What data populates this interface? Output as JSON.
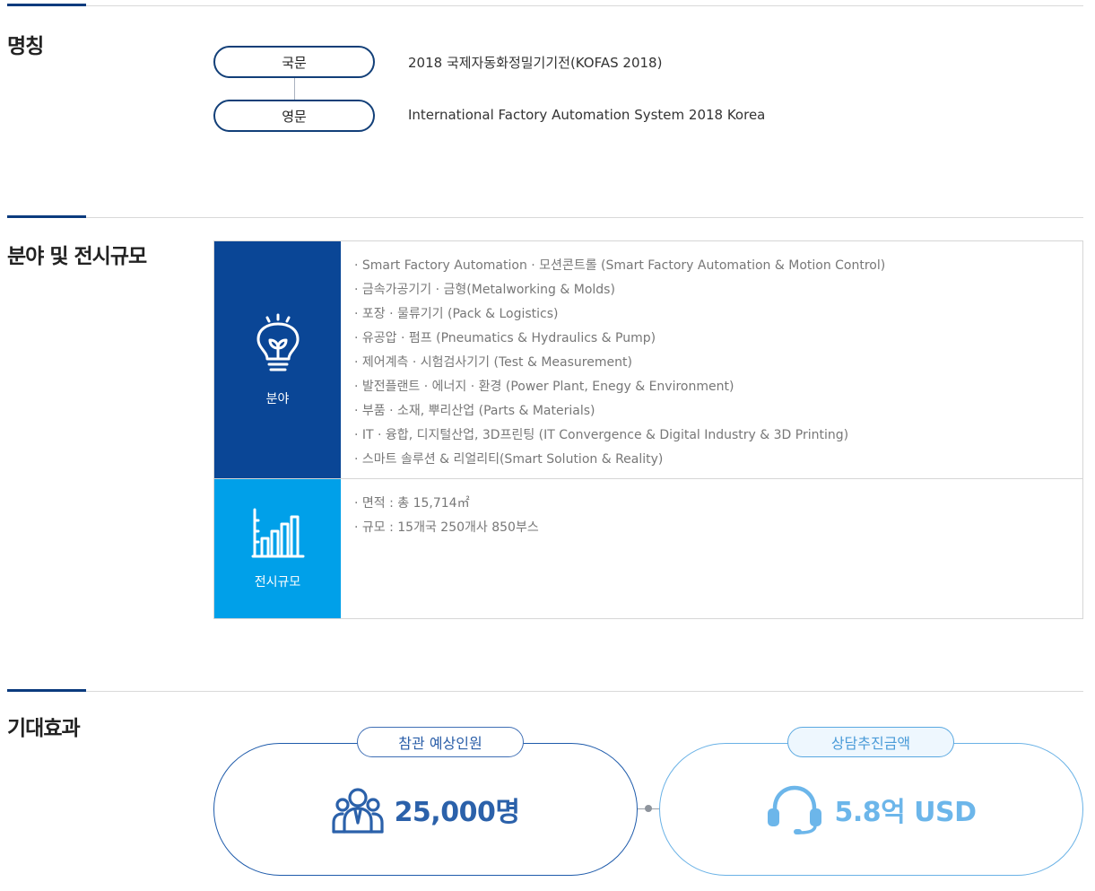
{
  "name_section": {
    "title": "명칭",
    "rows": [
      {
        "label": "국문",
        "value": "2018 국제자동화정밀기기전(KOFAS 2018)"
      },
      {
        "label": "영문",
        "value": "International Factory Automation System 2018 Korea"
      }
    ]
  },
  "field_section": {
    "title": "분야 및 전시규모",
    "field": {
      "label": "분야",
      "icon": "lightbulb-icon",
      "items": [
        "· Smart Factory Automation · 모션콘트롤 (Smart Factory Automation & Motion Control)",
        "· 금속가공기기 · 금형(Metalworking & Molds)",
        "· 포장 · 물류기기 (Pack & Logistics)",
        "· 유공압 · 펌프 (Pneumatics & Hydraulics & Pump)",
        "· 제어계측 · 시험검사기기 (Test & Measurement)",
        "· 발전플랜트 · 에너지 · 환경 (Power Plant, Enegy & Environment)",
        "· 부품 · 소재, 뿌리산업 (Parts & Materials)",
        "· IT · 융합, 디지털산업, 3D프린팅 (IT Convergence & Digital Industry & 3D Printing)",
        "· 스마트 솔루션 & 리얼리티(Smart Solution & Reality)"
      ]
    },
    "scale": {
      "label": "전시규모",
      "icon": "bar-chart-icon",
      "items": [
        "· 면적 : 총 15,714㎡",
        "· 규모 : 15개국 250개사 850부스"
      ]
    }
  },
  "effect_section": {
    "title": "기대효과",
    "visitors": {
      "label": "참관 예상인원",
      "value": "25,000명",
      "icon": "people-icon"
    },
    "consult": {
      "label": "상담추진금액",
      "value": "5.8억 USD",
      "icon": "headset-icon"
    }
  },
  "colors": {
    "navy": "#0a4696",
    "sky": "#00a0e9",
    "accent_dark": "#2b61aa",
    "accent_light": "#6cb6ea"
  }
}
